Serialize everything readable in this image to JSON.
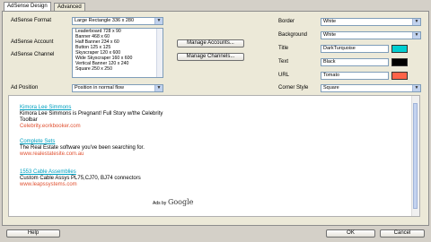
{
  "tabs": [
    {
      "label": "AdSense Design"
    },
    {
      "label": "Advanced"
    }
  ],
  "left": {
    "adsense_format_label": "AdSense Format",
    "adsense_format_value": "Large Rectangle 336 x 280",
    "adsense_account_label": "AdSense Account",
    "adsense_channel_label": "AdSense Channel",
    "manage_accounts": "Manage Accounts...",
    "manage_channels": "Manage Channels...",
    "ad_position_label": "Ad Position",
    "ad_position_value": "Position in normal flow"
  },
  "format_list": [
    "Leaderboard 728 x 90",
    "Banner 468 x 60",
    "Half Banner 234 x 60",
    "Button 125 x 125",
    "Skyscraper 120 x 600",
    "Wide Skyscraper 160 x 600",
    "Vertical Banner 120 x 240",
    "Square 250 x 250"
  ],
  "right": {
    "border_label": "Border",
    "border_value": "White",
    "background_label": "Background",
    "background_value": "White",
    "title_label": "Title",
    "title_value": "DarkTurquoise",
    "title_color": "#00ced1",
    "text_label": "Text",
    "text_value": "Black",
    "text_color": "#000000",
    "url_label": "URL",
    "url_value": "Tomato",
    "url_color": "#ff6347",
    "corner_label": "Corner Style",
    "corner_value": "Square"
  },
  "preview": {
    "ads": [
      {
        "title": "Kimora Lee Simmons",
        "line1": "Kimora Lee Simmons is Pregnant! Full Story w/the Celebrity",
        "line2": "Toolbar",
        "url": "Celebrity.eorkbooker.com"
      },
      {
        "title": "Complete Sets",
        "line1": "The Real Estate software you've been searching for.",
        "line2": "",
        "url": "www.realestatesite.com.au"
      },
      {
        "title": "1553 Cable Assemblies",
        "line1": "Custom Cable Assys PL75,CJ70, BJ74 connectors",
        "line2": "",
        "url": "www.leapssystems.com"
      }
    ],
    "ads_by_prefix": "Ads by",
    "ads_by_brand": "Google"
  },
  "footer": {
    "help": "Help",
    "ok": "OK",
    "cancel": "Cancel"
  }
}
